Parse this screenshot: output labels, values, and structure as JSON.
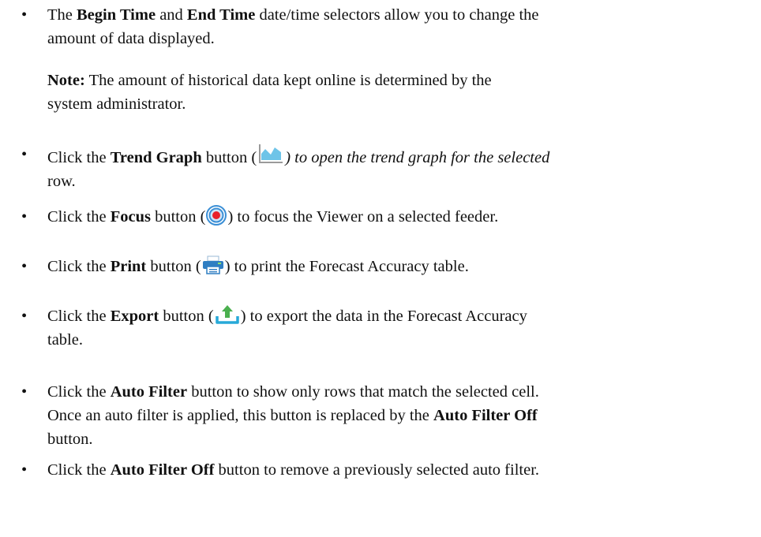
{
  "items": [
    {
      "bullet": "•",
      "pre1": "The ",
      "b1": "Begin Time",
      "mid1": " and ",
      "b2": "End Time",
      "post1": " date/time selectors allow you to change the",
      "line2": "amount of data displayed."
    },
    {
      "note_label": "Note:",
      "note_text1": " The amount of historical data kept online is determined by the",
      "note_text2": "system administrator."
    },
    {
      "bullet": "•",
      "pre": "Click the ",
      "bold": "Trend Graph",
      "mid": " button (",
      "icon": "trend-graph-icon",
      "post": ") to open the trend graph for the selected",
      "line2": "row."
    },
    {
      "bullet": "•",
      "pre": "Click the ",
      "bold": "Focus",
      "mid": " button (",
      "icon": "focus-target-icon",
      "post": ") to focus the Viewer on a selected feeder."
    },
    {
      "bullet": "•",
      "pre": "Click the ",
      "bold": "Print",
      "mid": " button (",
      "icon": "printer-icon",
      "post": ") to print the Forecast Accuracy table."
    },
    {
      "bullet": "•",
      "pre": "Click the ",
      "bold": "Export",
      "mid": " button (",
      "icon": "export-upload-icon",
      "post": ") to export the data in the Forecast Accuracy",
      "line2": "table."
    },
    {
      "bullet": "•",
      "pre": "Click the ",
      "bold": "Auto Filter",
      "post": " button to show only rows that match the selected cell.",
      "line2": "Once an auto filter is applied, this button is replaced by the ",
      "line2_bold": "Auto Filter Off",
      "line3": "button."
    },
    {
      "bullet": "•",
      "pre": "Click the ",
      "bold": "Auto Filter Off",
      "post": " button to remove a previously selected auto filter."
    }
  ],
  "colors": {
    "text": "#111111",
    "trend_icon": "#6ec4e8",
    "trend_icon_axis": "#9a9a9a",
    "focus_outer": "#3b8fd6",
    "focus_inner": "#e8202a",
    "print_icon": "#2f7ec2",
    "export_icon": "#27a9d8",
    "export_arrow": "#4bb04f"
  }
}
